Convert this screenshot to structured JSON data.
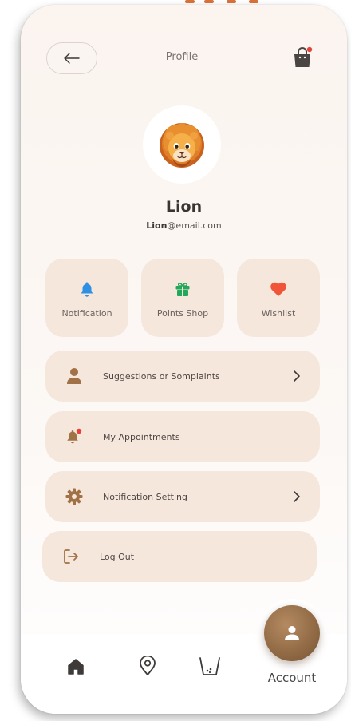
{
  "header": {
    "title": "Profile"
  },
  "profile": {
    "name": "Lion",
    "email_user": "Lion",
    "email_domain": "@email.com",
    "avatar_icon": "lion-face-icon"
  },
  "quick_actions": [
    {
      "label": "Notification",
      "icon": "bell-icon",
      "color": "#2f8fe0"
    },
    {
      "label": "Points Shop",
      "icon": "gift-icon",
      "color": "#22a85a"
    },
    {
      "label": "Wishlist",
      "icon": "heart-icon",
      "color": "#f0553a"
    }
  ],
  "menu": [
    {
      "label": "Suggestions or Somplaints",
      "icon": "person-icon",
      "has_chevron": true
    },
    {
      "label": "My Appointments",
      "icon": "bell-dot-icon",
      "has_chevron": false
    },
    {
      "label": "Notification Setting",
      "icon": "gear-icon",
      "has_chevron": true
    },
    {
      "label": "Log Out",
      "icon": "logout-icon",
      "has_chevron": false
    }
  ],
  "bottom_nav": {
    "items": [
      "home-icon",
      "location-pin-icon",
      "cart-icon"
    ],
    "active_label": "Account"
  },
  "colors": {
    "accent_brown": "#8a6440",
    "card_bg": "#f6e7dc",
    "icon_brown": "#a07246",
    "notification_dot": "#e5423a",
    "top_accent": "#d9723a"
  }
}
